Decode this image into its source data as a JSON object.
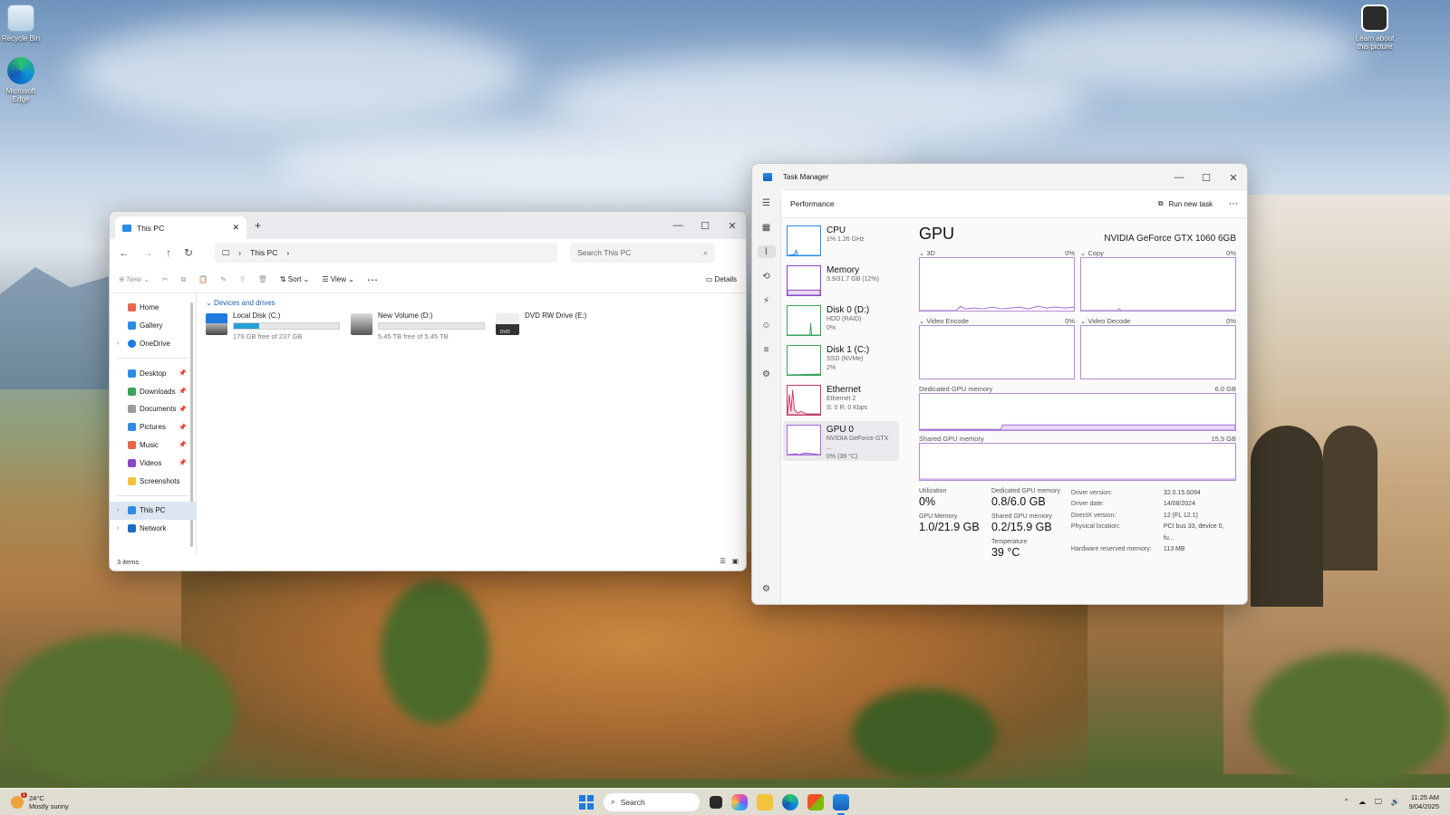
{
  "desktop": {
    "icons": [
      {
        "label": "Recycle Bin",
        "icon": "recycle-bin-icon"
      },
      {
        "label": "Microsoft Edge",
        "icon": "edge-icon"
      },
      {
        "label": "Learn about this picture",
        "icon": "learn-picture-icon"
      }
    ]
  },
  "explorer": {
    "tab_title": "This PC",
    "breadcrumb": "This PC",
    "search_placeholder": "Search This PC",
    "toolbar": {
      "new": "New",
      "sort": "Sort",
      "view": "View",
      "details": "Details"
    },
    "nav": {
      "home": "Home",
      "gallery": "Gallery",
      "onedrive": "OneDrive",
      "quick": [
        {
          "label": "Desktop",
          "icon": "desktop-icon"
        },
        {
          "label": "Downloads",
          "icon": "downloads-icon"
        },
        {
          "label": "Documents",
          "icon": "documents-icon"
        },
        {
          "label": "Pictures",
          "icon": "pictures-icon"
        },
        {
          "label": "Music",
          "icon": "music-icon"
        },
        {
          "label": "Videos",
          "icon": "videos-icon"
        },
        {
          "label": "Screenshots",
          "icon": "folder-icon"
        }
      ],
      "this_pc": "This PC",
      "network": "Network"
    },
    "group_title": "Devices and drives",
    "drives": [
      {
        "name": "Local Disk (C:)",
        "free": "179 GB free of 237 GB",
        "used_fraction": 0.245
      },
      {
        "name": "New Volume (D:)",
        "free": "5.45 TB free of 5.45 TB",
        "used_fraction": 0.0
      },
      {
        "name": "DVD RW Drive (E:)",
        "free": "",
        "badge": "DVD"
      }
    ],
    "status": "3 items"
  },
  "taskmgr": {
    "title": "Task Manager",
    "section": "Performance",
    "run_new_task": "Run new task",
    "devices": [
      {
        "name": "CPU",
        "sub1": "1% 1.26 GHz",
        "sub2": ""
      },
      {
        "name": "Memory",
        "sub1": "3.9/31.7 GB (12%)",
        "sub2": ""
      },
      {
        "name": "Disk 0 (D:)",
        "sub1": "HDD (RAID)",
        "sub2": "0%"
      },
      {
        "name": "Disk 1 (C:)",
        "sub1": "SSD (NVMe)",
        "sub2": "2%"
      },
      {
        "name": "Ethernet",
        "sub1": "Ethernet 2",
        "sub2": "S: 0 R: 0 Kbps"
      },
      {
        "name": "GPU 0",
        "sub1": "NVIDIA GeForce GTX ...",
        "sub2": "0% (39 °C)"
      }
    ],
    "gpu": {
      "heading": "GPU",
      "model": "NVIDIA GeForce GTX 1060 6GB",
      "engines": [
        {
          "label": "3D",
          "pct": "0%"
        },
        {
          "label": "Copy",
          "pct": "0%"
        },
        {
          "label": "Video Encode",
          "pct": "0%"
        },
        {
          "label": "Video Decode",
          "pct": "0%"
        }
      ],
      "dedicated_label": "Dedicated GPU memory",
      "dedicated_max": "6.0 GB",
      "shared_label": "Shared GPU memory",
      "shared_max": "15.9 GB",
      "stats": {
        "utilization_label": "Utilization",
        "utilization": "0%",
        "dedicated_label": "Dedicated GPU memory",
        "dedicated": "0.8/6.0 GB",
        "gpu_memory_label": "GPU Memory",
        "gpu_memory": "1.0/21.9 GB",
        "shared_label": "Shared GPU memory",
        "shared": "0.2/15.9 GB",
        "temperature_label": "Temperature",
        "temperature": "39 °C"
      },
      "info": [
        {
          "k": "Driver version:",
          "v": "32.0.15.6094"
        },
        {
          "k": "Driver date:",
          "v": "14/08/2024"
        },
        {
          "k": "DirectX version:",
          "v": "12 (FL 12.1)"
        },
        {
          "k": "Physical location:",
          "v": "PCI bus 33, device 0, fu..."
        },
        {
          "k": "Hardware reserved memory:",
          "v": "113 MB"
        }
      ]
    }
  },
  "taskbar": {
    "temp": "24°C",
    "weather": "Mostly sunny",
    "weather_badge": "1",
    "search": "Search",
    "time": "11:25 AM",
    "date": "9/04/2025"
  },
  "colors": {
    "accent": "#1e7ae0",
    "gpu_line": "#a56ad9",
    "drive_bar": "#26a0da"
  }
}
